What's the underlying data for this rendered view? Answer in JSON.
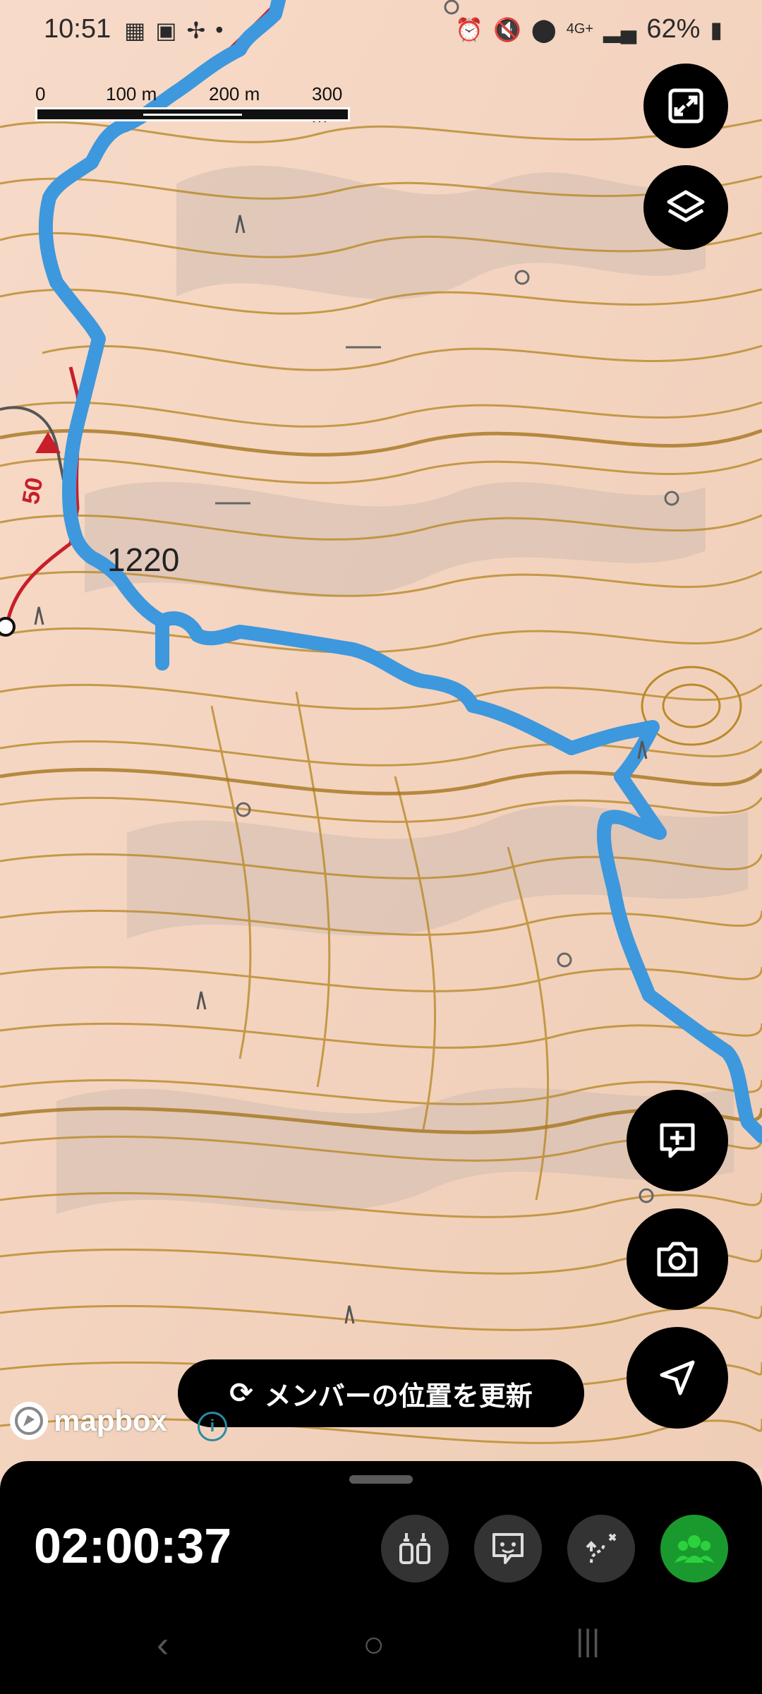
{
  "status": {
    "time": "10:51",
    "left_icons": [
      "calendar-icon",
      "image-icon",
      "fan-icon",
      "dot-icon"
    ],
    "right_icons": [
      "alarm-icon",
      "mute-icon",
      "location-icon",
      "4g-icon",
      "signal-icon"
    ],
    "battery": "62%"
  },
  "scale": {
    "labels": [
      "0",
      "100 m",
      "200 m",
      "300 m"
    ]
  },
  "map": {
    "elevation_label": "1220",
    "route_marker": "50",
    "route_color": "#3d98dd",
    "contour_color": "#b98a2a"
  },
  "buttons": {
    "fullscreen": "fullscreen-icon",
    "layers": "layers-icon",
    "add_note": "add-note-icon",
    "camera": "camera-icon",
    "locate": "locate-icon"
  },
  "update_pill": {
    "label": "メンバーの位置を更新"
  },
  "attribution": {
    "brand": "mapbox"
  },
  "bottom": {
    "timer": "02:00:37",
    "tools": [
      "gear-list-icon",
      "chat-icon",
      "route-icon",
      "members-icon"
    ]
  },
  "nav": {
    "back": "‹",
    "home": "○",
    "recent": "|||"
  }
}
